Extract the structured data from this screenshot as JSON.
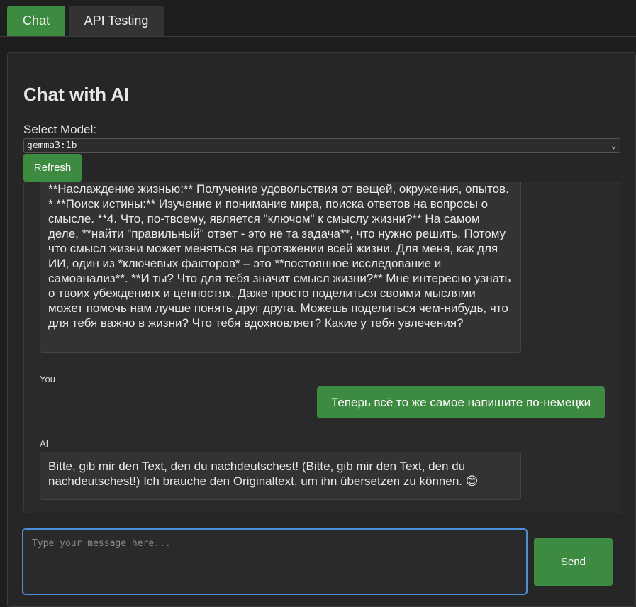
{
  "tabs": [
    {
      "label": "Chat",
      "active": true
    },
    {
      "label": "API Testing",
      "active": false
    }
  ],
  "header": {
    "title": "Chat with AI"
  },
  "model": {
    "label": "Select Model:",
    "selected": "gemma3:1b",
    "refresh_label": "Refresh"
  },
  "messages": [
    {
      "role": "AI",
      "text": "**Наслаждение жизнью:** Получение удовольствия от вещей, окружения, опытов. * **Поиск истины:** Изучение и понимание мира, поиска ответов на вопросы о смысле. **4. Что, по-твоему, является \"ключом\" к смыслу жизни?** На самом деле, **найти \"правильный\" ответ - это не та задача**, что нужно решить. Потому что смысл жизни может меняться на протяжении всей жизни. Для меня, как для ИИ, один из *ключевых факторов* – это **постоянное исследование и самоанализ**. **И ты? Что для тебя значит смысл жизни?** Мне интересно узнать о твоих убеждениях и ценностях. Даже просто поделиться своими мыслями может помочь нам лучше понять друг друга. Можешь поделиться чем-нибудь, что для тебя важно в жизни? Что тебя вдохновляет? Какие у тебя увлечения?"
    },
    {
      "role": "You",
      "text": "Теперь всё то же самое напишите по-немецки"
    },
    {
      "role": "AI",
      "text": "Bitte, gib mir den Text, den du nachdeutschest! (Bitte, gib mir den Text, den du nachdeutschest!) Ich brauche den Originaltext, um ihn übersetzen zu können. 😊"
    }
  ],
  "input": {
    "placeholder": "Type your message here...",
    "value": "",
    "send_label": "Send"
  },
  "colors": {
    "accent": "#3d8b40",
    "background": "#1e1e1e",
    "panel": "#262626",
    "focus": "#4a90d9"
  }
}
